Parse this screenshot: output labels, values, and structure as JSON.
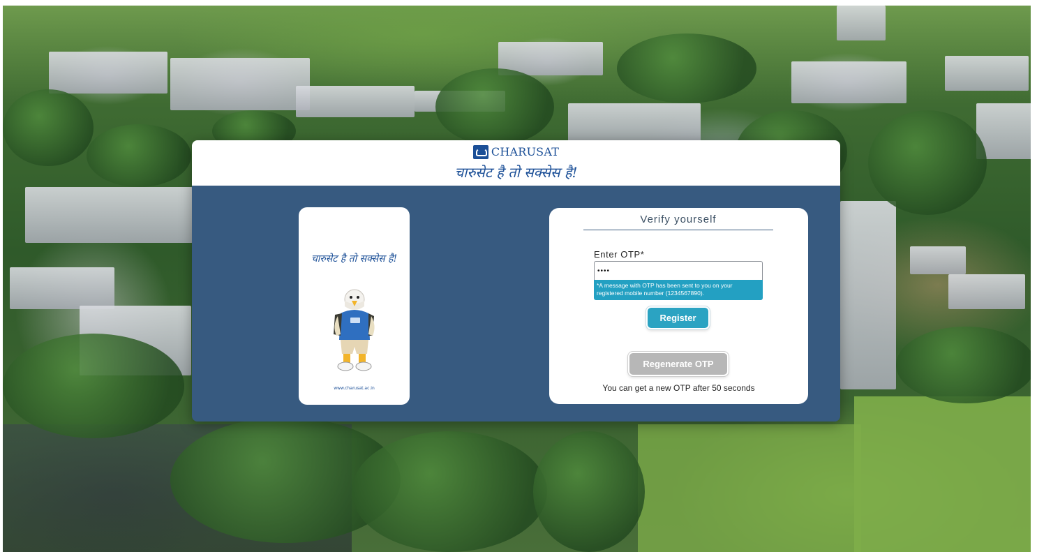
{
  "header": {
    "logo_text": "CHARUSAT",
    "tagline": "चारुसेट है तो सक्सेस है!"
  },
  "poster": {
    "tagline": "चारुसेट है तो सक्सेस है!",
    "url": "www.charusat.ac.in"
  },
  "verify": {
    "title": "Verify yourself",
    "otp_label": "Enter OTP*",
    "otp_value": "••••",
    "otp_help": "*A message with OTP has been sent to you on your registered mobile number (1234567890).",
    "register_label": "Register",
    "regenerate_label": "Regenerate OTP",
    "resend_note": "You can get a new OTP after 50 seconds"
  },
  "colors": {
    "brand_blue": "#1b4f97",
    "panel_blue": "#375a80",
    "accent_teal": "#2ba3c2",
    "disabled_gray": "#b7b7b7"
  }
}
